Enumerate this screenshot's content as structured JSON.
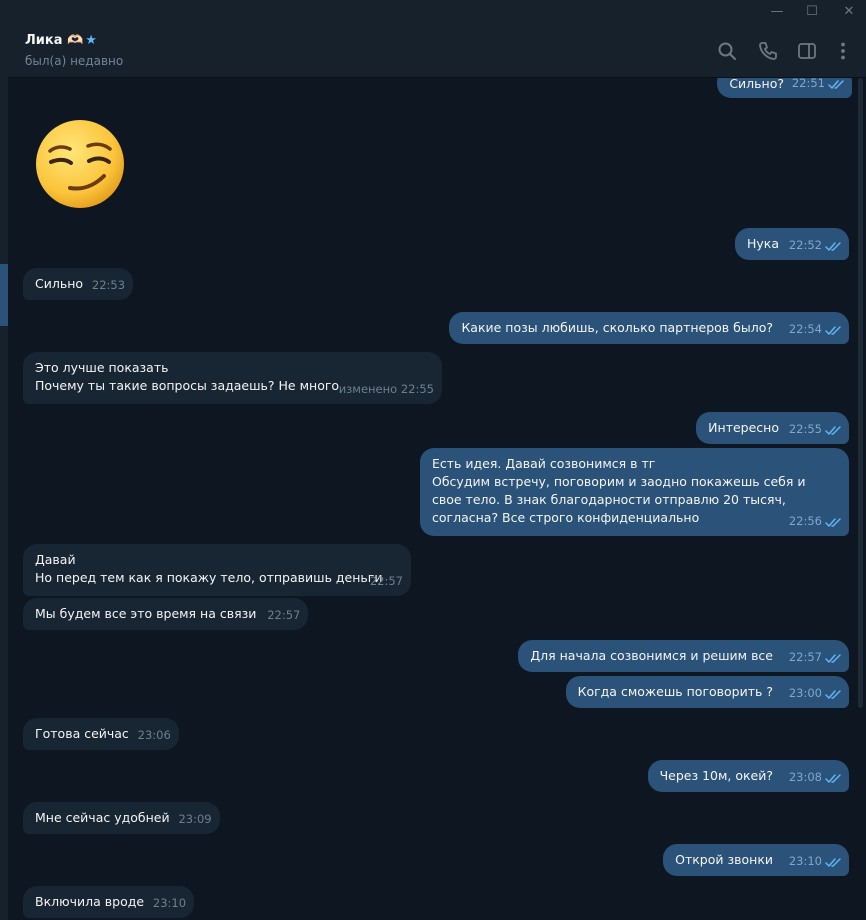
{
  "window": {
    "minimize_glyph": "—",
    "maximize_glyph": "☐",
    "close_glyph": "✕"
  },
  "header": {
    "name": "Лика 🫶🏻",
    "star": "★",
    "status": "был(а) недавно",
    "icons": [
      "search-icon",
      "phone-icon",
      "sidebar-toggle-icon",
      "more-vertical-icon"
    ]
  },
  "colors": {
    "background": "#0e1621",
    "incoming_bubble": "#182533",
    "outgoing_bubble": "#2b5278",
    "read_check": "#5eb5f7"
  },
  "sticker": {
    "icon": "smirk-emoji-sticker"
  },
  "messages": [
    {
      "dir": "out",
      "text": "Сильно?",
      "time": "22:51",
      "read": true
    },
    {
      "dir": "out",
      "text": "Нука",
      "time": "22:52",
      "read": true
    },
    {
      "dir": "in",
      "text": "Сильно",
      "time": "22:53"
    },
    {
      "dir": "out",
      "text": "Какие позы любишь, сколько партнеров было?",
      "time": "22:54",
      "read": true
    },
    {
      "dir": "in",
      "text": "Это лучше показать\nПочему ты такие вопросы задаешь? Не много",
      "time": "изменено 22:55"
    },
    {
      "dir": "out",
      "text": "Интересно",
      "time": "22:55",
      "read": true
    },
    {
      "dir": "out",
      "text": "Есть идея. Давай созвонимся в тг\nОбсудим встречу, поговорим и заодно покажешь себя и свое тело. В знак благодарности отправлю 20 тысяч, согласна? Все строго конфиденциально",
      "time": "22:56",
      "read": true
    },
    {
      "dir": "in",
      "text": "Давай\nНо перед тем как я покажу тело, отправишь деньги",
      "time": "22:57"
    },
    {
      "dir": "in",
      "text": "Мы будем все это время на связи",
      "time": "22:57"
    },
    {
      "dir": "out",
      "text": "Для начала созвонимся и решим все",
      "time": "22:57",
      "read": true
    },
    {
      "dir": "out",
      "text": "Когда сможешь поговорить ?",
      "time": "23:00",
      "read": true
    },
    {
      "dir": "in",
      "text": "Готова сейчас",
      "time": "23:06"
    },
    {
      "dir": "out",
      "text": "Через 10м, окей?",
      "time": "23:08",
      "read": true
    },
    {
      "dir": "in",
      "text": "Мне сейчас удобней",
      "time": "23:09"
    },
    {
      "dir": "out",
      "text": "Открой звонки",
      "time": "23:10",
      "read": true
    },
    {
      "dir": "in",
      "text": "Включила вроде",
      "time": "23:10"
    }
  ]
}
